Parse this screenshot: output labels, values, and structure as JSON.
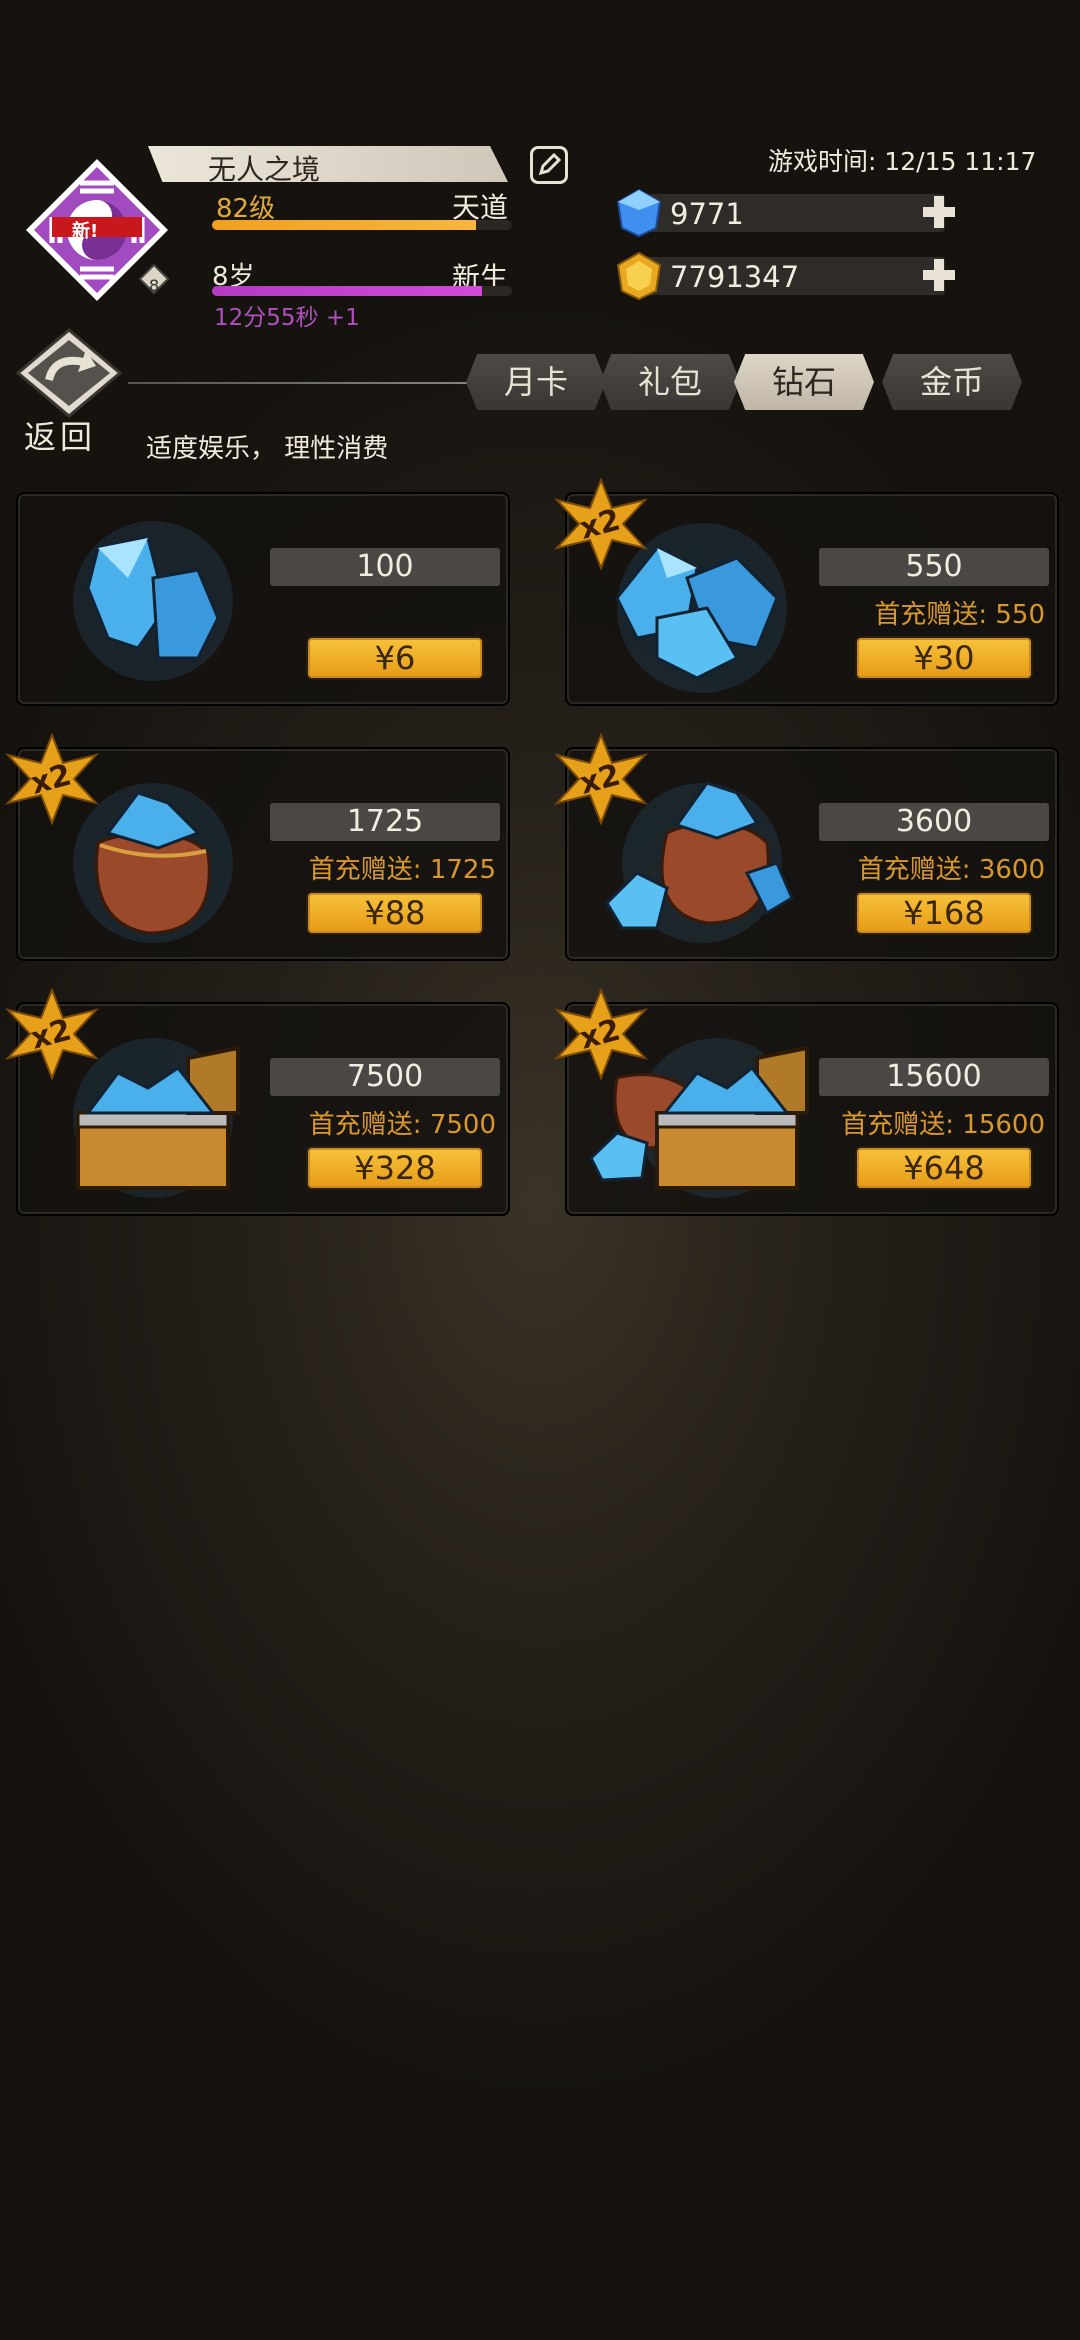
{
  "header": {
    "emblem_badge": "新!",
    "emblem_level": "8",
    "player_name": "无人之境",
    "level": "82级",
    "realm": "天道",
    "age": "8岁",
    "stage": "新生",
    "timer": "12分55秒 +1",
    "game_time": "游戏时间: 12/15 11:17",
    "level_progress": 0.88,
    "age_progress": 0.9
  },
  "resources": {
    "diamonds": "9771",
    "gold": "7791347"
  },
  "nav": {
    "back_label": "返回",
    "tabs": [
      {
        "label": "月卡"
      },
      {
        "label": "礼包"
      },
      {
        "label": "钻石"
      },
      {
        "label": "金币"
      }
    ],
    "active_tab": "钻石",
    "notice": "适度娱乐， 理性消费"
  },
  "products": [
    {
      "amount": "100",
      "bonus": "",
      "price": "¥6",
      "double": false,
      "art": "crystals-small"
    },
    {
      "amount": "550",
      "bonus": "首充赠送: 550",
      "price": "¥30",
      "double": true,
      "art": "crystals-pile"
    },
    {
      "amount": "1725",
      "bonus": "首充赠送: 1725",
      "price": "¥88",
      "double": true,
      "art": "sack"
    },
    {
      "amount": "3600",
      "bonus": "首充赠送: 3600",
      "price": "¥168",
      "double": true,
      "art": "sack-crystals"
    },
    {
      "amount": "7500",
      "bonus": "首充赠送: 7500",
      "price": "¥328",
      "double": true,
      "art": "chest"
    },
    {
      "amount": "15600",
      "bonus": "首充赠送: 15600",
      "price": "¥648",
      "double": true,
      "art": "chest-sack"
    }
  ],
  "badge_text": "x2",
  "colors": {
    "accent_gold": "#f0a020",
    "accent_purple": "#b43ac4",
    "bonus_text": "#d9982c",
    "price_button": "#f0b030"
  }
}
